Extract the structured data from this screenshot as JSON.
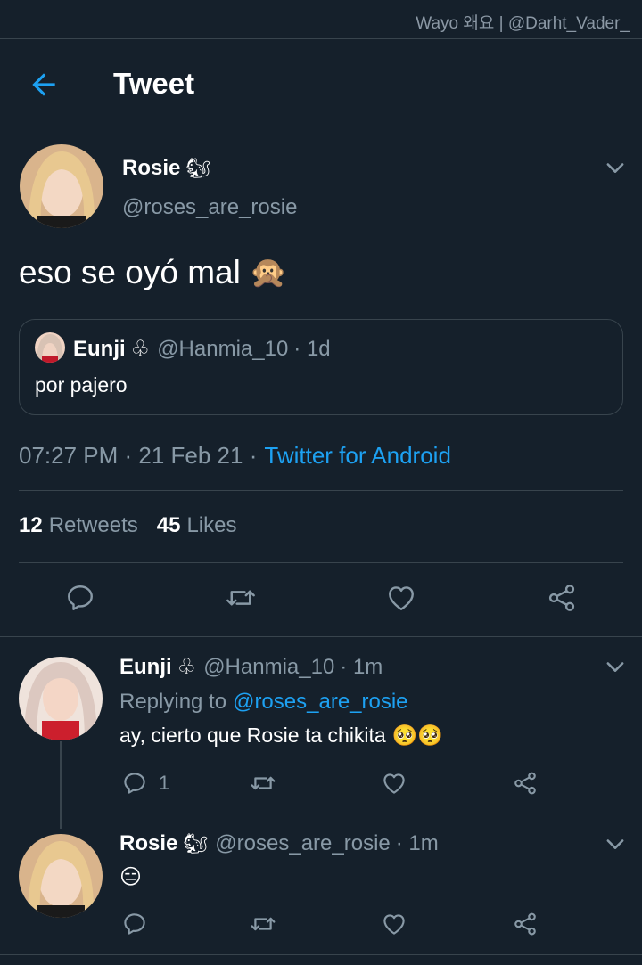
{
  "watermark": "Wayo 왜요 | @Darht_Vader_",
  "header": {
    "title": "Tweet"
  },
  "tweet": {
    "author_name": "Rosie",
    "author_emoji": "🐿",
    "author_handle": "@roses_are_rosie",
    "text": "eso se oyó mal",
    "text_emoji": "🙊",
    "quote": {
      "name": "Eunji",
      "suit": "♧",
      "handle": "@Hanmia_10",
      "time": "· 1d",
      "text": "por pajero"
    },
    "meta_time": "07:27 PM · 21 Feb 21 ·",
    "meta_source": "Twitter for Android",
    "retweets_count": "12",
    "retweets_label": "Retweets",
    "likes_count": "45",
    "likes_label": "Likes"
  },
  "replies": [
    {
      "name": "Eunji",
      "suit": "♧",
      "handle": "@Hanmia_10",
      "time": "· 1m",
      "replying_label": "Replying to",
      "replying_handle": "@roses_are_rosie",
      "text": "ay, cierto que Rosie ta chikita",
      "text_emoji": "🥺🥺",
      "reply_count": "1"
    },
    {
      "name": "Rosie",
      "emoji": "🐿",
      "handle": "@roses_are_rosie",
      "time": "· 1m",
      "text": "😑"
    }
  ],
  "colors": {
    "background": "#15202b",
    "divider": "#38444d",
    "muted": "#8899a6",
    "accent": "#1da1f2",
    "thread_line": "#38444d"
  }
}
